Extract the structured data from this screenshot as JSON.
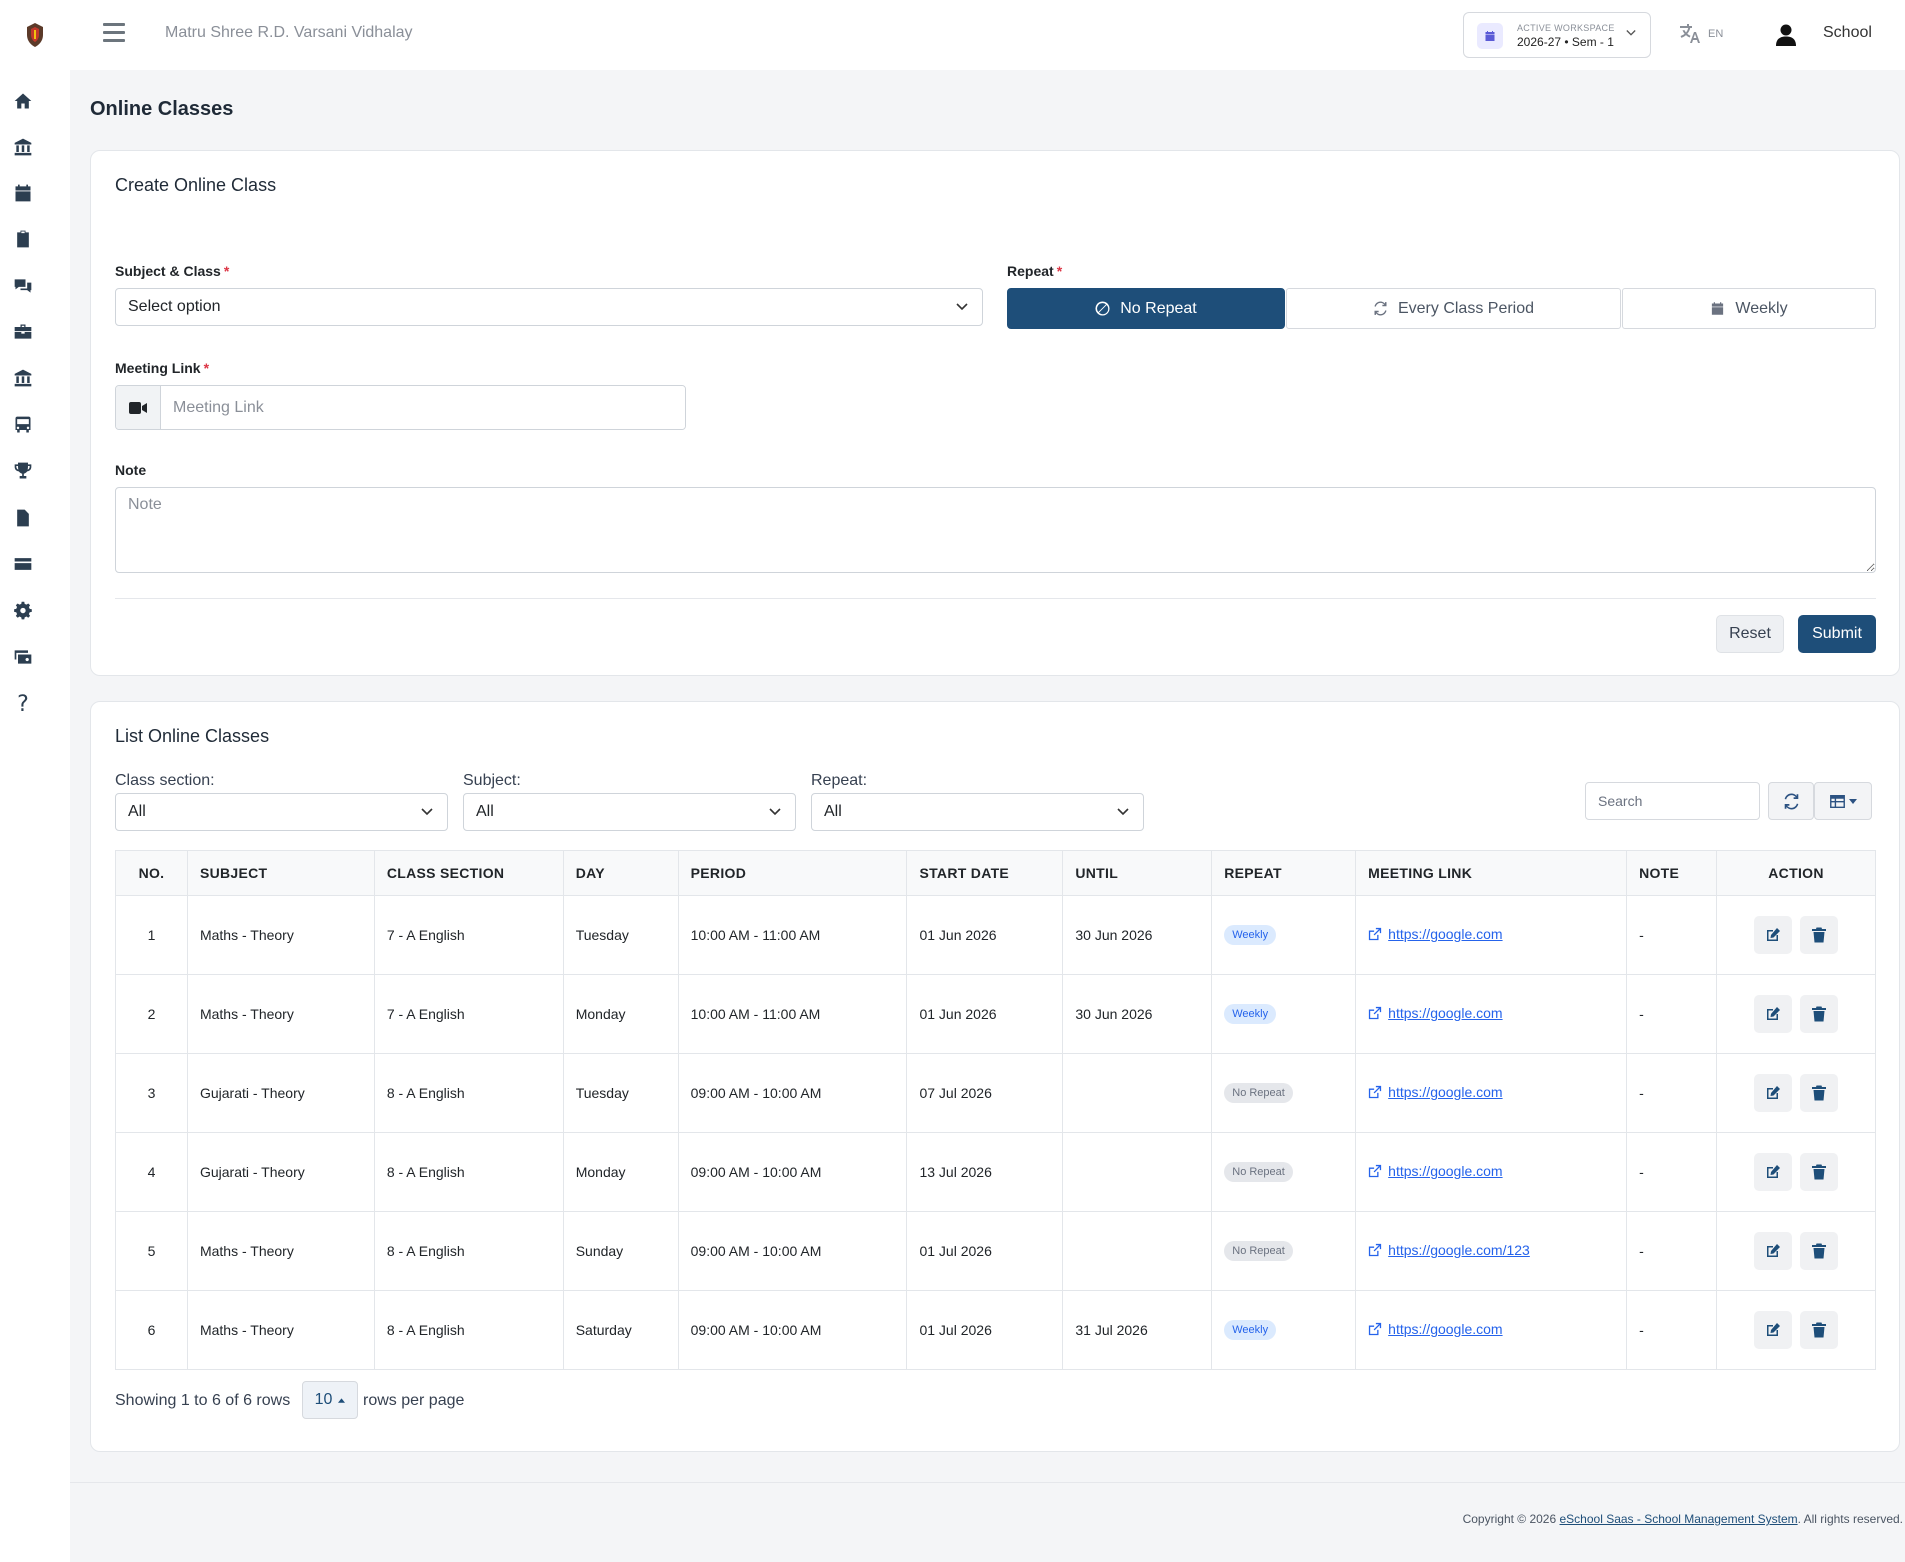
{
  "topbar": {
    "school_name": "Matru Shree R.D. Varsani Vidhalay",
    "workspace_caption": "ACTIVE WORKSPACE",
    "workspace_value": "2026-27 • Sem - 1",
    "language": "EN",
    "user_name": "School"
  },
  "page": {
    "title": "Online Classes"
  },
  "create": {
    "title": "Create Online Class",
    "subject_label": "Subject & Class",
    "subject_value": "Select option",
    "repeat_label": "Repeat",
    "repeat_options": [
      "No Repeat",
      "Every Class Period",
      "Weekly"
    ],
    "repeat_selected": "No Repeat",
    "meeting_label": "Meeting Link",
    "meeting_placeholder": "Meeting Link",
    "note_label": "Note",
    "note_placeholder": "Note",
    "reset_label": "Reset",
    "submit_label": "Submit"
  },
  "list": {
    "title": "List Online Classes",
    "filters": {
      "class_section_label": "Class section:",
      "class_section_value": "All",
      "subject_label": "Subject:",
      "subject_value": "All",
      "repeat_label": "Repeat:",
      "repeat_value": "All"
    },
    "search_placeholder": "Search",
    "columns": [
      "NO.",
      "SUBJECT",
      "CLASS SECTION",
      "DAY",
      "PERIOD",
      "START DATE",
      "UNTIL",
      "REPEAT",
      "MEETING LINK",
      "NOTE",
      "ACTION"
    ],
    "rows": [
      {
        "no": "1",
        "subject": "Maths - Theory",
        "class_section": "7 - A English",
        "day": "Tuesday",
        "period": "10:00 AM - 11:00 AM",
        "start_date": "01 Jun 2026",
        "until": "30 Jun 2026",
        "repeat": "Weekly",
        "link": "https://google.com",
        "note": "-"
      },
      {
        "no": "2",
        "subject": "Maths - Theory",
        "class_section": "7 - A English",
        "day": "Monday",
        "period": "10:00 AM - 11:00 AM",
        "start_date": "01 Jun 2026",
        "until": "30 Jun 2026",
        "repeat": "Weekly",
        "link": "https://google.com",
        "note": "-"
      },
      {
        "no": "3",
        "subject": "Gujarati - Theory",
        "class_section": "8 - A English",
        "day": "Tuesday",
        "period": "09:00 AM - 10:00 AM",
        "start_date": "07 Jul 2026",
        "until": "",
        "repeat": "No Repeat",
        "link": "https://google.com",
        "note": "-"
      },
      {
        "no": "4",
        "subject": "Gujarati - Theory",
        "class_section": "8 - A English",
        "day": "Monday",
        "period": "09:00 AM - 10:00 AM",
        "start_date": "13 Jul 2026",
        "until": "",
        "repeat": "No Repeat",
        "link": "https://google.com",
        "note": "-"
      },
      {
        "no": "5",
        "subject": "Maths - Theory",
        "class_section": "8 - A English",
        "day": "Sunday",
        "period": "09:00 AM - 10:00 AM",
        "start_date": "01 Jul 2026",
        "until": "",
        "repeat": "No Repeat",
        "link": "https://google.com/123",
        "note": "-"
      },
      {
        "no": "6",
        "subject": "Maths - Theory",
        "class_section": "8 - A English",
        "day": "Saturday",
        "period": "09:00 AM - 10:00 AM",
        "start_date": "01 Jul 2026",
        "until": "31 Jul 2026",
        "repeat": "Weekly",
        "link": "https://google.com",
        "note": "-"
      }
    ],
    "pagination": {
      "showing_text": "Showing 1 to 6 of 6 rows",
      "page_size": "10",
      "rows_per_page_text": "rows per page"
    }
  },
  "footer": {
    "prefix": "Copyright © 2026 ",
    "link_text": "eSchool Saas - School Management System",
    "suffix": ". All rights reserved."
  },
  "colors": {
    "primary": "#1e4e79",
    "required": "#dc3545",
    "weekly_badge_bg": "#dbeafe",
    "weekly_badge_text": "#2563eb",
    "norepeat_badge_bg": "#e5e7eb",
    "link": "#2563eb"
  },
  "icons": {
    "sidebar": [
      "home-icon",
      "institution-icon",
      "calendar-icon",
      "clipboard-icon",
      "chat-icon",
      "briefcase-icon",
      "bank-icon",
      "bus-icon",
      "trophy-icon",
      "document-icon",
      "credit-card-icon",
      "gear-icon",
      "money-check-icon",
      "help-icon"
    ]
  }
}
